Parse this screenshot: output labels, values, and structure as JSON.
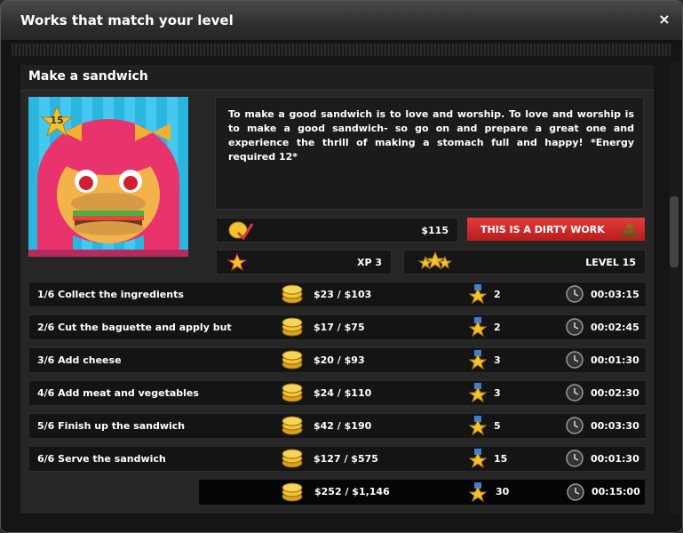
{
  "window": {
    "title": "Works that match your level",
    "close_icon": "×"
  },
  "job": {
    "title": "Make a sandwich",
    "portrait_level": "15",
    "description": "To make a good sandwich is to love and worship. To love and worship is to make a good sandwich- so go on and prepare a great one and experience the thrill of making a stomach full and happy! *Energy required 12*",
    "reward": "$115",
    "dirty_label": "THIS IS A DIRTY WORK",
    "xp": "XP 3",
    "level": "LEVEL 15"
  },
  "steps": [
    {
      "label": "1/6 Collect the ingredients",
      "money": "$23 / $103",
      "xp": "2",
      "time": "00:03:15"
    },
    {
      "label": "2/6 Cut the baguette and apply but",
      "money": "$17 / $75",
      "xp": "2",
      "time": "00:02:45"
    },
    {
      "label": "3/6 Add cheese",
      "money": "$20 / $93",
      "xp": "3",
      "time": "00:01:30"
    },
    {
      "label": "4/6 Add meat and vegetables",
      "money": "$24 / $110",
      "xp": "3",
      "time": "00:02:30"
    },
    {
      "label": "5/6 Finish up the sandwich",
      "money": "$42 / $190",
      "xp": "5",
      "time": "00:03:30"
    },
    {
      "label": "6/6 Serve the sandwich",
      "money": "$127 / $575",
      "xp": "15",
      "time": "00:01:30"
    }
  ],
  "total": {
    "money": "$252 / $1,146",
    "xp": "30",
    "time": "00:15:00"
  },
  "colors": {
    "dirty": "#d42b2b",
    "accent_gold": "#f2c230",
    "panel": "#262626"
  }
}
